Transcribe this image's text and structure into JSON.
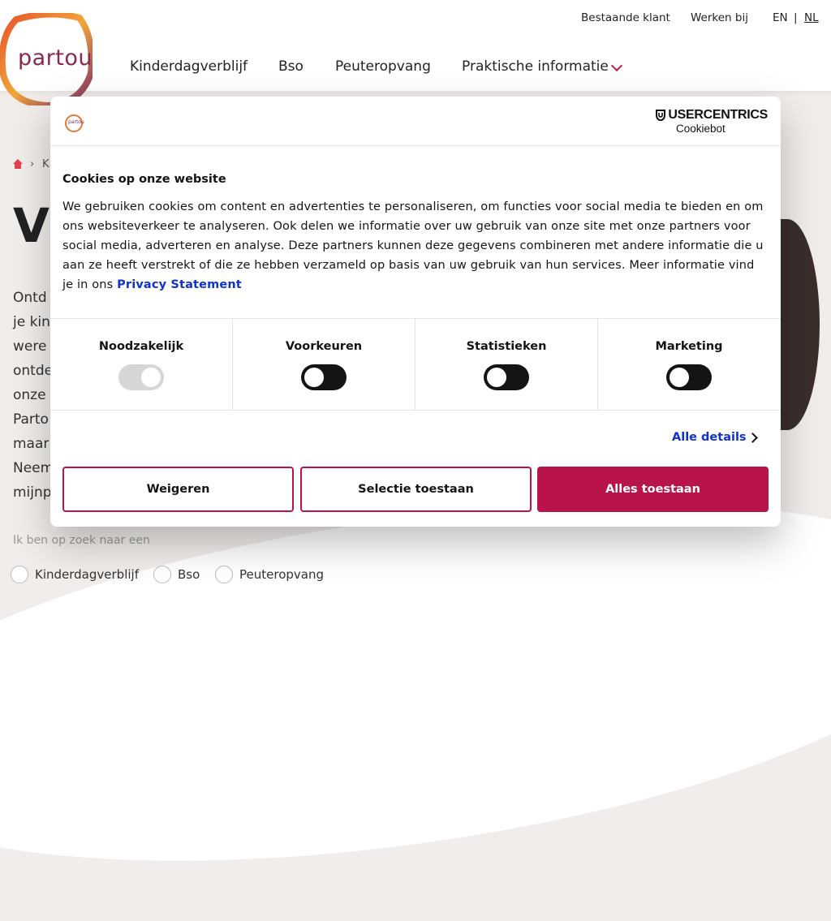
{
  "header": {
    "logo_text": "partou",
    "top_links": {
      "existing_customer": "Bestaande klant",
      "careers": "Werken bij",
      "lang_en": "EN",
      "lang_sep": "|",
      "lang_nl": "NL"
    },
    "nav": [
      "Kinderdagverblijf",
      "Bso",
      "Peuteropvang",
      "Praktische informatie"
    ]
  },
  "background": {
    "breadcrumb_sep": "›",
    "breadcrumb_partial": "K",
    "title_partial": "V",
    "body_lines": [
      "Ontd",
      "je kin",
      "were",
      "ontde",
      "onze",
      "Parto",
      "maar",
      "Neem",
      "mijnp"
    ],
    "search_label": "Ik ben op zoek naar een",
    "radios": [
      "Kinderdagverblijf",
      "Bso",
      "Peuteropvang"
    ]
  },
  "dialog": {
    "brand": "USERCENTRICS",
    "brand_sub": "Cookiebot",
    "logo_text": "partou",
    "title": "Cookies op onze website",
    "body": "We gebruiken cookies om content en advertenties te personaliseren, om functies voor social media te bieden en om ons websiteverkeer te analyseren. Ook delen we informatie over uw gebruik van onze site met onze partners voor social media, adverteren en analyse. Deze partners kunnen deze gegevens combineren met andere informatie die u aan ze heeft verstrekt of die ze hebben verzameld op basis van uw gebruik van hun services. Meer informatie vind je in ons",
    "privacy_link": "Privacy Statement",
    "categories": [
      {
        "label": "Noodzakelijk",
        "state": "on-disabled"
      },
      {
        "label": "Voorkeuren",
        "state": "off"
      },
      {
        "label": "Statistieken",
        "state": "off"
      },
      {
        "label": "Marketing",
        "state": "off"
      }
    ],
    "details_link": "Alle details",
    "buttons": {
      "reject": "Weigeren",
      "allow_selection": "Selectie toestaan",
      "allow_all": "Alles toestaan"
    },
    "accent_color": "#b8144a",
    "link_color": "#1032cf"
  }
}
